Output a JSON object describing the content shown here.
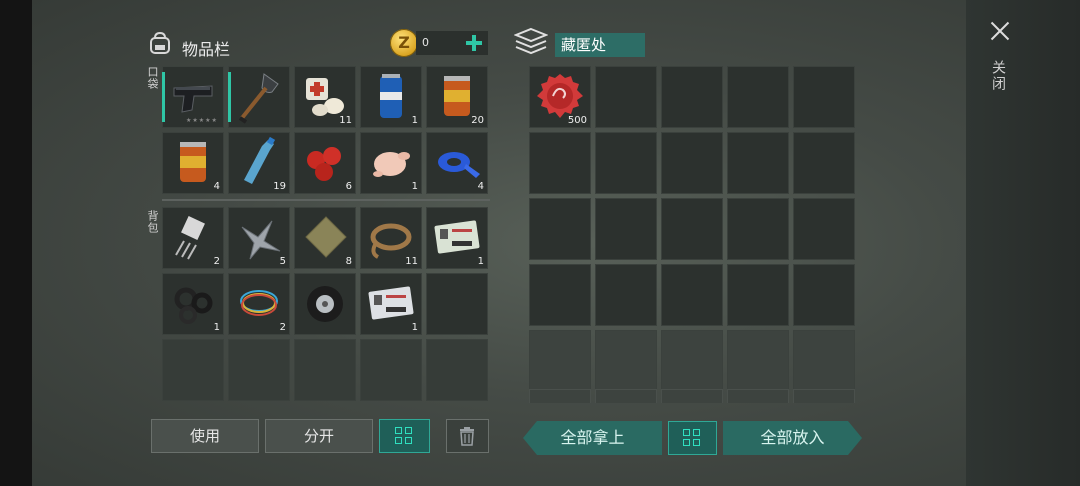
{
  "inventory": {
    "title": "物品栏",
    "currency": {
      "value": "0"
    },
    "pocket_label": "口袋",
    "backpack_label": "背包",
    "pocket_items": [
      {
        "name": "pistol",
        "qty": "",
        "stars": "★★★★★",
        "accent": true
      },
      {
        "name": "shovel",
        "qty": "",
        "accent": true
      },
      {
        "name": "bandage",
        "qty": "11"
      },
      {
        "name": "soda-can",
        "qty": "1"
      },
      {
        "name": "canned-food",
        "qty": "20"
      },
      {
        "name": "canned-food",
        "qty": "4"
      },
      {
        "name": "water-bottle",
        "qty": "19"
      },
      {
        "name": "tomatoes",
        "qty": "6"
      },
      {
        "name": "raw-chicken",
        "qty": "1"
      },
      {
        "name": "blue-tape",
        "qty": "4"
      }
    ],
    "backpack_items": [
      {
        "name": "transistor",
        "qty": "2"
      },
      {
        "name": "scrap-metal",
        "qty": "5"
      },
      {
        "name": "cloth",
        "qty": "8"
      },
      {
        "name": "rope",
        "qty": "11"
      },
      {
        "name": "army-card-a",
        "qty": "1"
      },
      {
        "name": "rubber-seals",
        "qty": "1"
      },
      {
        "name": "wires",
        "qty": "2"
      },
      {
        "name": "tire",
        "qty": ""
      },
      {
        "name": "army-card-c",
        "qty": "1"
      },
      {
        "name": "empty",
        "qty": ""
      }
    ]
  },
  "stash": {
    "title": "藏匿处",
    "items": [
      {
        "name": "bottle-cap",
        "qty": "500"
      }
    ]
  },
  "buttons": {
    "use": "使用",
    "split": "分开",
    "take_all": "全部拿上",
    "put_all": "全部放入"
  },
  "close_label": "关闭",
  "colors": {
    "accent": "#2fc6a6",
    "teal_button": "#2a6a62"
  }
}
